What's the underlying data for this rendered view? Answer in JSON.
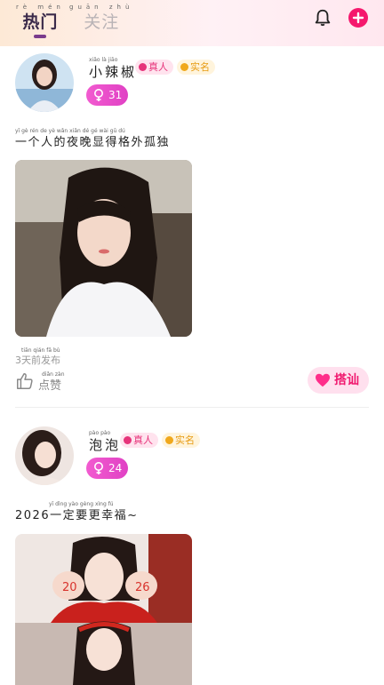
{
  "tabs": {
    "hot": {
      "label": "热门",
      "pinyin": "rè mén"
    },
    "follow": {
      "label": "关注",
      "pinyin": "guān zhù"
    }
  },
  "header_icons": [
    "bell-icon",
    "plus-icon"
  ],
  "posts": [
    {
      "username": "小辣椒",
      "username_pinyin": "xiǎo là jiāo",
      "badge_real": "真人",
      "badge_verified": "实名",
      "age": "31",
      "content": "一个人的夜晚显得格外孤独",
      "content_pinyin": "yī gè rén de yè wǎn xiǎn dé gé wài gū dú",
      "time": "3天前发布",
      "time_pinyin": "tiān qián fā bù",
      "like_label": "点赞",
      "like_pinyin": "diǎn zàn",
      "chat_label": "搭讪"
    },
    {
      "username": "泡泡",
      "username_pinyin": "pào pào",
      "badge_real": "真人",
      "badge_verified": "实名",
      "age": "24",
      "content": "2026一定要更幸福~",
      "content_pinyin": "yī dìng yào gèng xìng fú"
    }
  ],
  "colors": {
    "accent_pink": "#f5186d",
    "age_pill": "#e84acb",
    "verify_orange": "#f0a81c"
  }
}
